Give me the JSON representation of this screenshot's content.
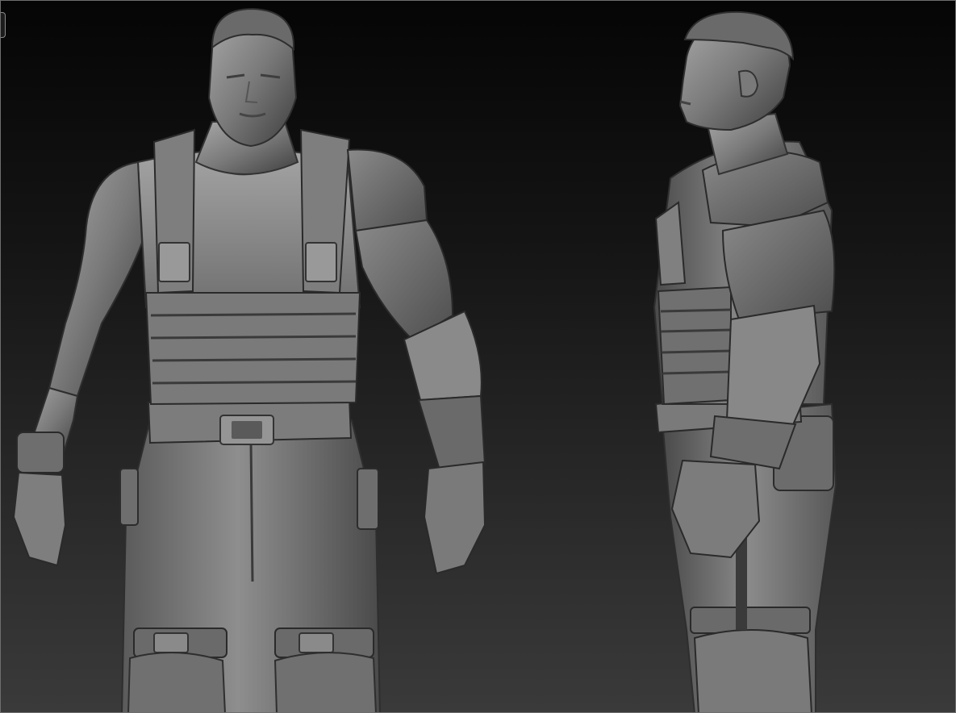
{
  "viewport": {
    "background_top": "#050505",
    "background_bottom": "#3a3a3a",
    "frame_color": "#6e6e6e"
  },
  "model": {
    "material_light": "#9a9a9a",
    "material_mid": "#6a6a6a",
    "material_dark": "#3c3c3c"
  },
  "views": [
    "front-view",
    "side-view"
  ]
}
